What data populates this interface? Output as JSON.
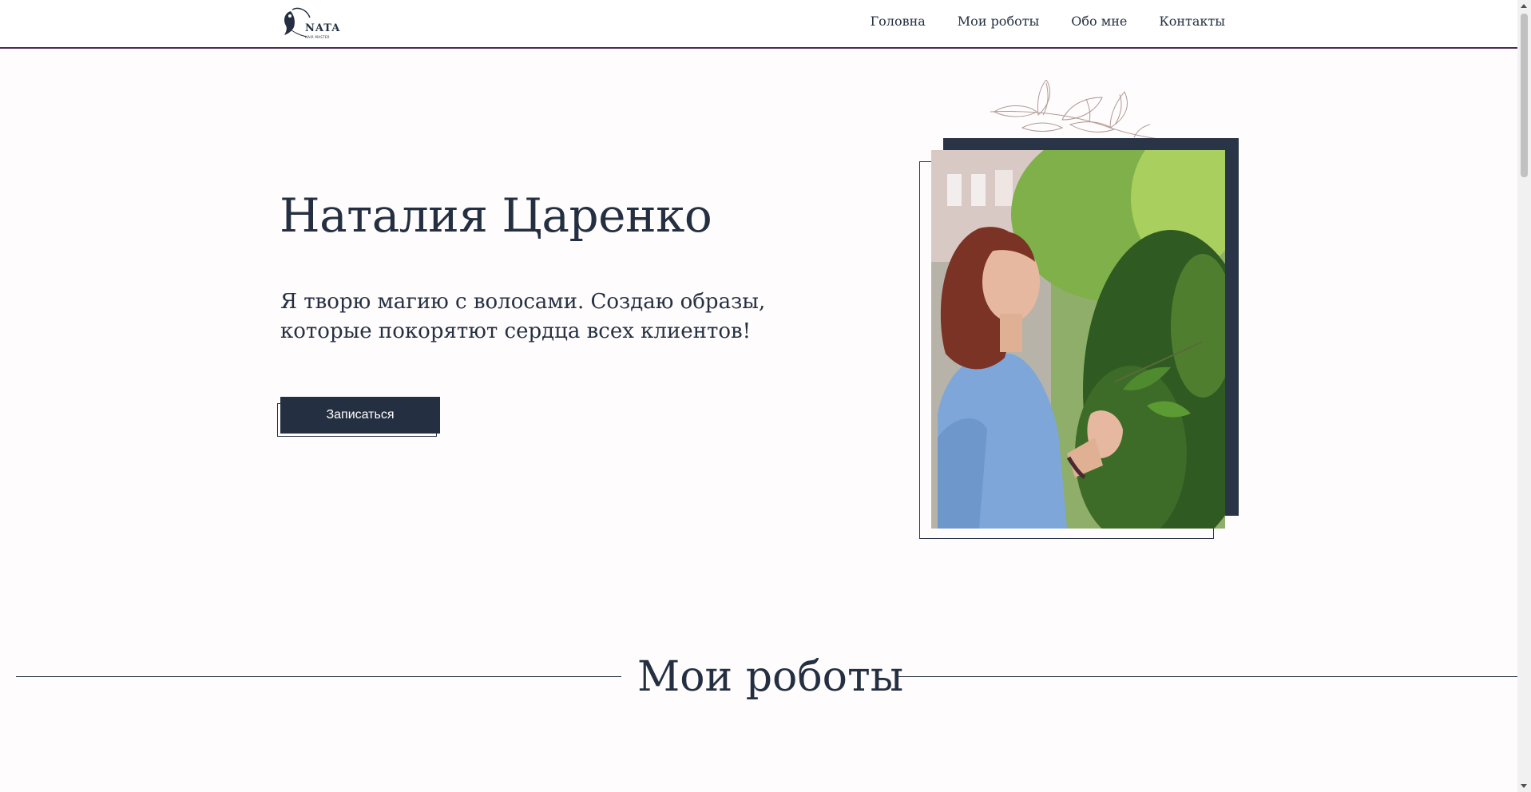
{
  "header": {
    "logo": {
      "text": "NATA",
      "subtext": "HAIR MASTER"
    },
    "nav": [
      {
        "label": "Головна"
      },
      {
        "label": "Мои роботы"
      },
      {
        "label": "Обо мне"
      },
      {
        "label": "Контакты"
      }
    ]
  },
  "hero": {
    "title": "Наталия Царенко",
    "subtitle": "Я творю магию с волосами. Создаю образы, которые покорятют сердца всех клиентов!",
    "cta_label": "Записаться"
  },
  "section": {
    "title": "Мои роботы"
  },
  "colors": {
    "primary": "#243041",
    "accent_line": "#4a2a58",
    "background": "#fffcfd",
    "leaf": "#b09a94"
  },
  "icons": [
    "logo-woman-silhouette-icon",
    "leaf-branch-icon"
  ]
}
